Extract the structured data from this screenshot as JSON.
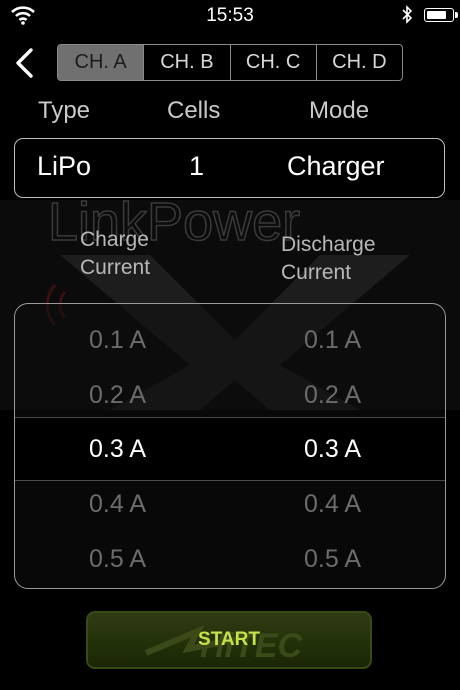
{
  "status_bar": {
    "time": "15:53",
    "battery_level": 0.85
  },
  "nav": {
    "back_icon": "chevron-left-icon"
  },
  "tabs": [
    {
      "label": "CH. A",
      "active": true
    },
    {
      "label": "CH. B",
      "active": false
    },
    {
      "label": "CH. C",
      "active": false
    },
    {
      "label": "CH. D",
      "active": false
    }
  ],
  "config": {
    "headers": {
      "type": "Type",
      "cells": "Cells",
      "mode": "Mode"
    },
    "values": {
      "type": "LiPo",
      "cells": "1",
      "mode": "Charger"
    }
  },
  "watermark": {
    "text": "LinkPower"
  },
  "current": {
    "charge_label_line1": "Charge",
    "charge_label_line2": "Current",
    "discharge_label_line1": "Discharge",
    "discharge_label_line2": "Current",
    "charge_options": [
      "0.1 A",
      "0.2 A",
      "0.3 A",
      "0.4 A",
      "0.5 A"
    ],
    "discharge_options": [
      "0.1 A",
      "0.2 A",
      "0.3 A",
      "0.4 A",
      "0.5 A"
    ],
    "selected_charge": "0.3 A",
    "selected_discharge": "0.3 A"
  },
  "start_button": {
    "label": "START",
    "logo_text": "HiTEC"
  },
  "colors": {
    "accent": "#c6e24a",
    "active_tab": "#707070"
  }
}
